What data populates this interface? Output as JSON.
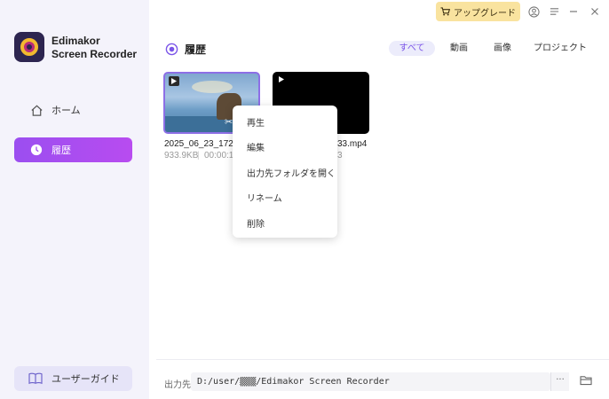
{
  "app": {
    "name_line1": "Edimakor",
    "name_line2": "Screen Recorder"
  },
  "sidebar": {
    "home_label": "ホーム",
    "history_label": "履歴",
    "guide_label": "ユーザーガイド"
  },
  "toolbar": {
    "upgrade_label": "アップグレード"
  },
  "page": {
    "title": "履歴"
  },
  "filters": [
    "すべて",
    "動画",
    "画像",
    "プロジェクト"
  ],
  "files": [
    {
      "name": "2025_06_23_172027",
      "size": "933.9KB",
      "duration": "00:00:18"
    },
    {
      "name": "33.mp4",
      "size": "",
      "duration": "3"
    }
  ],
  "context_menu": [
    "再生",
    "編集",
    "出力先フォルダを開く",
    "リネーム",
    "削除"
  ],
  "output": {
    "label": "出力先",
    "path": "D:/user/▒▒▒/Edimakor Screen Recorder",
    "more_label": "···"
  },
  "colors": {
    "accent": "#9b4ef0",
    "upgrade": "#f9e39f",
    "sidebar_bg": "#f4f3fb"
  }
}
